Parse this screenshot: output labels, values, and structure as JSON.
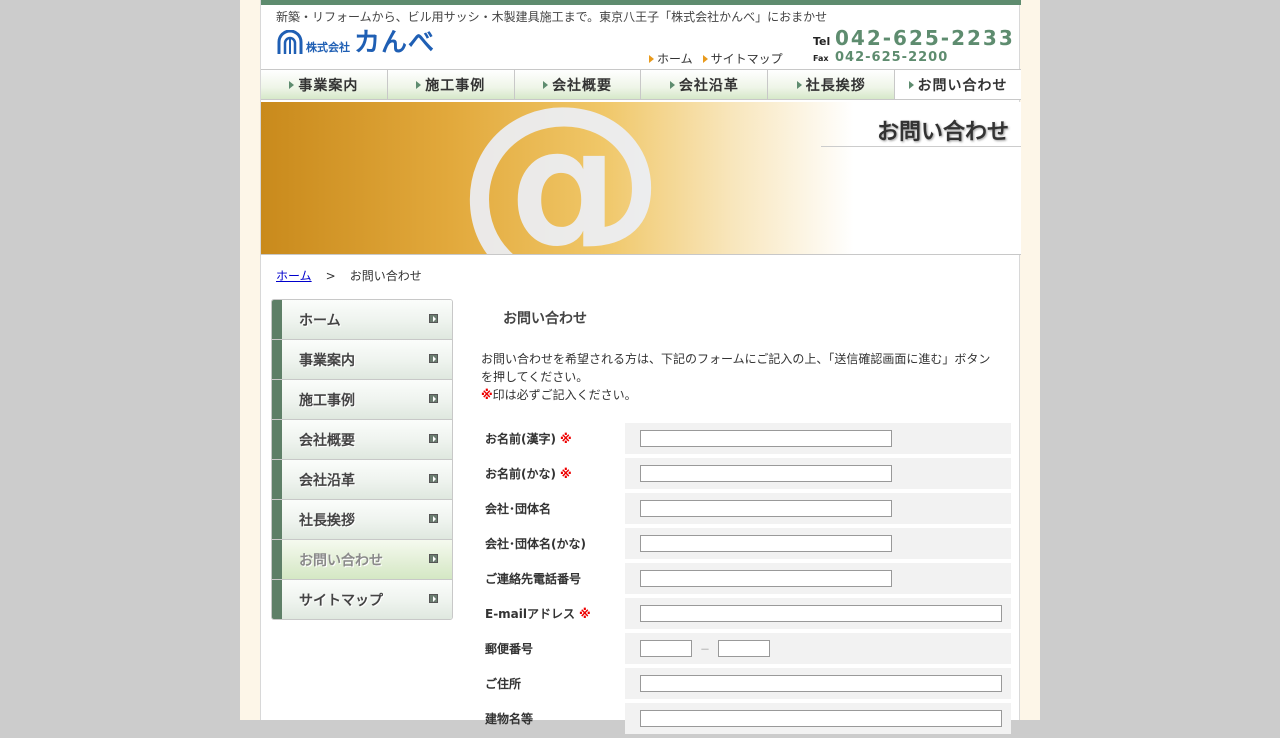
{
  "header": {
    "tagline": "新築・リフォームから、ビル用サッシ・木製建具施工まで。東京八王子「株式会社かんべ」におまかせ",
    "logo_small": "株式会社",
    "logo_big": "カんべ",
    "links": [
      "ホーム",
      "サイトマップ"
    ],
    "tel_label": "Tel",
    "tel": "042-625-2233",
    "fax_label": "Fax",
    "fax": "042-625-2200"
  },
  "gnav": [
    "事業案内",
    "施工事例",
    "会社概要",
    "会社沿革",
    "社長挨拶",
    "お問い合わせ"
  ],
  "hero": {
    "title": "お問い合わせ",
    "glyph": "@"
  },
  "breadcrumb": {
    "home": "ホーム",
    "sep": ">",
    "current": "お問い合わせ"
  },
  "sidebar": [
    "ホーム",
    "事業案内",
    "施工事例",
    "会社概要",
    "会社沿革",
    "社長挨拶",
    "お問い合わせ",
    "サイトマップ"
  ],
  "main": {
    "heading": "お問い合わせ",
    "intro1": "お問い合わせを希望される方は、下記のフォームにご記入の上、「送信確認画面に進む」ボタンを押してください。",
    "req_mark": "※",
    "intro2": "印は必ずご記入ください。"
  },
  "form": {
    "name_kanji": "お名前(漢字)",
    "name_kana": "お名前(かな)",
    "company": "会社･団体名",
    "company_kana": "会社･団体名(かな)",
    "phone": "ご連絡先電話番号",
    "email": "E-mailアドレス",
    "zip": "郵便番号",
    "zip_dash": "－",
    "address": "ご住所",
    "building": "建物名等",
    "req": "※"
  },
  "colors": {
    "brand_green": "#5e8c6f",
    "logo_blue": "#1f5fb4",
    "required_red": "#ee0000"
  }
}
